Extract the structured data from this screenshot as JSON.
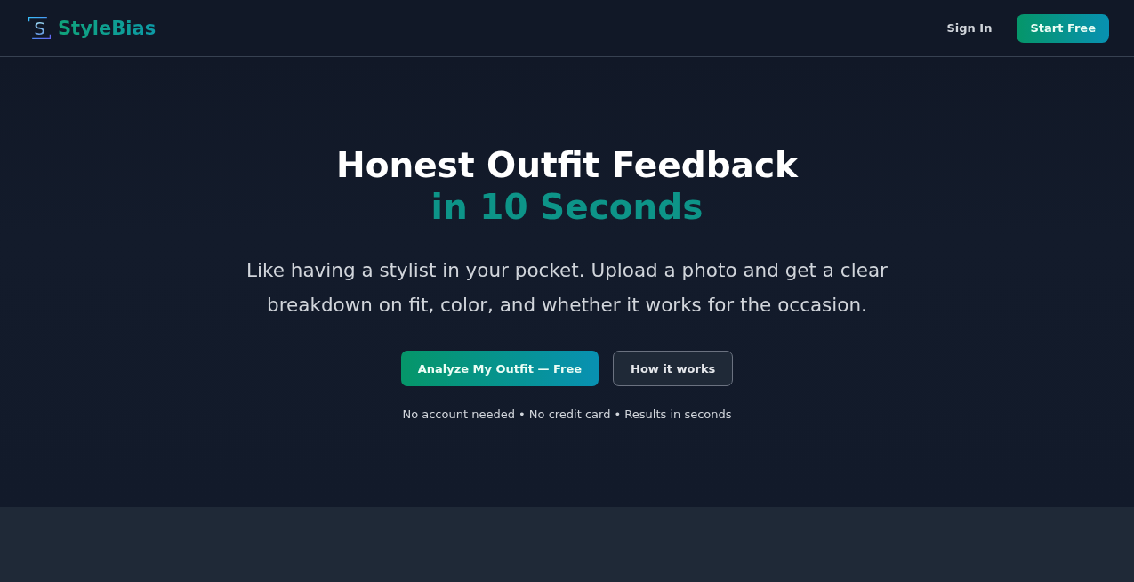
{
  "header": {
    "logo": {
      "mark": "S",
      "text": "StyleBias"
    },
    "nav": [
      {
        "label": "Sign In",
        "kind": "link"
      },
      {
        "label": "Start Free",
        "kind": "primary"
      }
    ]
  },
  "hero": {
    "title": "Honest Outfit Feedback",
    "title_accent": "in 10 Seconds",
    "subtitle": "Like having a stylist in your pocket. Upload a photo and get a clear breakdown on fit, color, and whether it works for the occasion.",
    "buttons": [
      {
        "label": "Analyze My Outfit — Free",
        "kind": "primary"
      },
      {
        "label": "How it works",
        "kind": "secondary"
      }
    ],
    "note": "No account needed • No credit card • Results in seconds"
  }
}
